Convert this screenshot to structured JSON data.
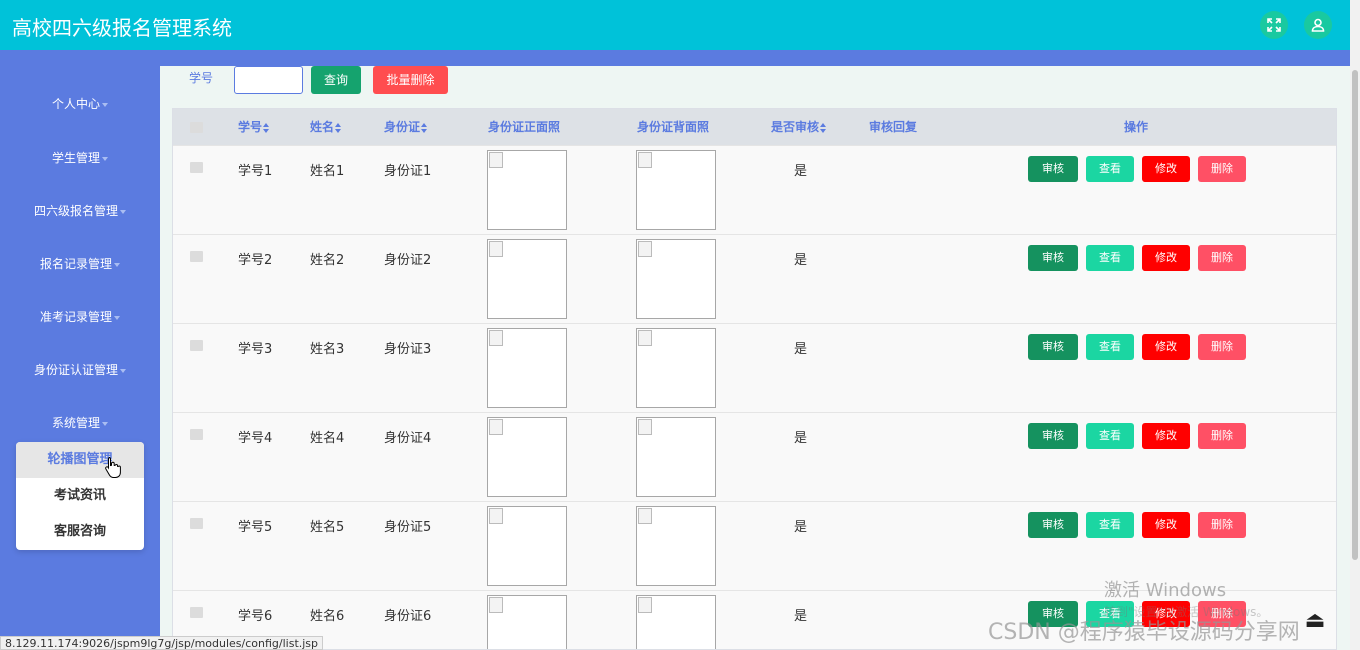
{
  "header": {
    "title": "高校四六级报名管理系统",
    "fullscreen_icon": "fullscreen-icon",
    "user_icon": "user-icon"
  },
  "sidebar": {
    "items": [
      {
        "label": "个人中心"
      },
      {
        "label": "学生管理"
      },
      {
        "label": "四六级报名管理"
      },
      {
        "label": "报名记录管理"
      },
      {
        "label": "准考记录管理"
      },
      {
        "label": "身份证认证管理"
      },
      {
        "label": "系统管理"
      }
    ],
    "submenu": [
      {
        "label": "轮播图管理"
      },
      {
        "label": "考试资讯"
      },
      {
        "label": "客服咨询"
      }
    ]
  },
  "search": {
    "label": "学号",
    "value": "",
    "query_button": "查询",
    "batch_delete_button": "批量删除"
  },
  "table": {
    "columns": [
      "学号",
      "姓名",
      "身份证",
      "身份证正面照",
      "身份证背面照",
      "是否审核",
      "审核回复",
      "操作"
    ],
    "rows": [
      {
        "id": "学号1",
        "name": "姓名1",
        "idcard": "身份证1",
        "audited": "是",
        "reply": ""
      },
      {
        "id": "学号2",
        "name": "姓名2",
        "idcard": "身份证2",
        "audited": "是",
        "reply": ""
      },
      {
        "id": "学号3",
        "name": "姓名3",
        "idcard": "身份证3",
        "audited": "是",
        "reply": ""
      },
      {
        "id": "学号4",
        "name": "姓名4",
        "idcard": "身份证4",
        "audited": "是",
        "reply": ""
      },
      {
        "id": "学号5",
        "name": "姓名5",
        "idcard": "身份证5",
        "audited": "是",
        "reply": ""
      },
      {
        "id": "学号6",
        "name": "姓名6",
        "idcard": "身份证6",
        "audited": "是",
        "reply": ""
      }
    ],
    "actions": {
      "audit": "审核",
      "view": "查看",
      "edit": "修改",
      "delete": "删除"
    }
  },
  "overlay": {
    "windows_activate": "激活 Windows",
    "windows_activate_sub": "转到\"设置\"以激活 Windows。",
    "csdn_watermark": "CSDN @程序猿毕设源码分享网"
  },
  "status_url": "8.129.11.174:9026/jspm9lg7g/jsp/modules/config/list.jsp",
  "colors": {
    "topbar": "#00c2d9",
    "sidebar": "#5b7be0",
    "audit": "#15925f",
    "view": "#1bd6a2",
    "edit": "#ff0000",
    "delete": "#ff5065"
  }
}
